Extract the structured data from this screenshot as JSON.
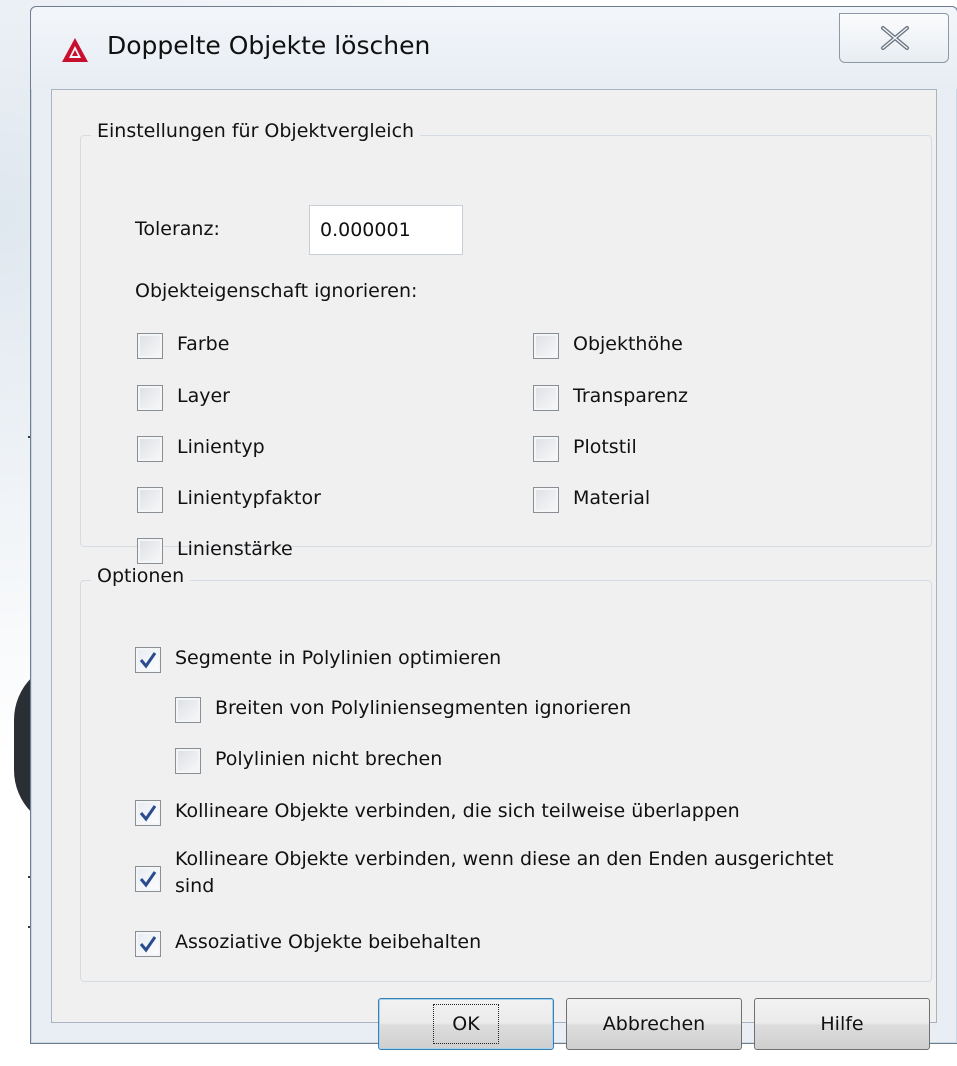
{
  "window": {
    "title": "Doppelte Objekte löschen",
    "close_icon": "close-x-icon",
    "app_icon": "autocad-logo-icon"
  },
  "comparison": {
    "group_label": "Einstellungen für Objektvergleich",
    "tolerance_label": "Toleranz:",
    "tolerance_value": "0.000001",
    "ignore_label": "Objekteigenschaft ignorieren:",
    "properties_left": [
      {
        "label": "Farbe",
        "checked": false
      },
      {
        "label": "Layer",
        "checked": false
      },
      {
        "label": "Linientyp",
        "checked": false
      },
      {
        "label": "Linientypfaktor",
        "checked": false
      },
      {
        "label": "Linienstärke",
        "checked": false
      }
    ],
    "properties_right": [
      {
        "label": "Objekthöhe",
        "checked": false
      },
      {
        "label": "Transparenz",
        "checked": false
      },
      {
        "label": "Plotstil",
        "checked": false
      },
      {
        "label": "Material",
        "checked": false
      }
    ]
  },
  "options": {
    "group_label": "Optionen",
    "items": [
      {
        "label": "Segmente in Polylinien optimieren",
        "checked": true
      },
      {
        "label": "Breiten von Polyliniensegmenten ignorieren",
        "checked": false
      },
      {
        "label": "Polylinien nicht brechen",
        "checked": false
      },
      {
        "label": "Kollineare Objekte verbinden, die sich teilweise überlappen",
        "checked": true
      },
      {
        "label": "Kollineare Objekte verbinden, wenn diese an den Enden ausgerichtet sind",
        "checked": true
      },
      {
        "label": "Assoziative Objekte beibehalten",
        "checked": true
      }
    ]
  },
  "buttons": {
    "ok": "OK",
    "cancel": "Abbrechen",
    "help": "Hilfe"
  },
  "colors": {
    "accent_red": "#c8102e",
    "check_blue": "#2a4b8d"
  }
}
